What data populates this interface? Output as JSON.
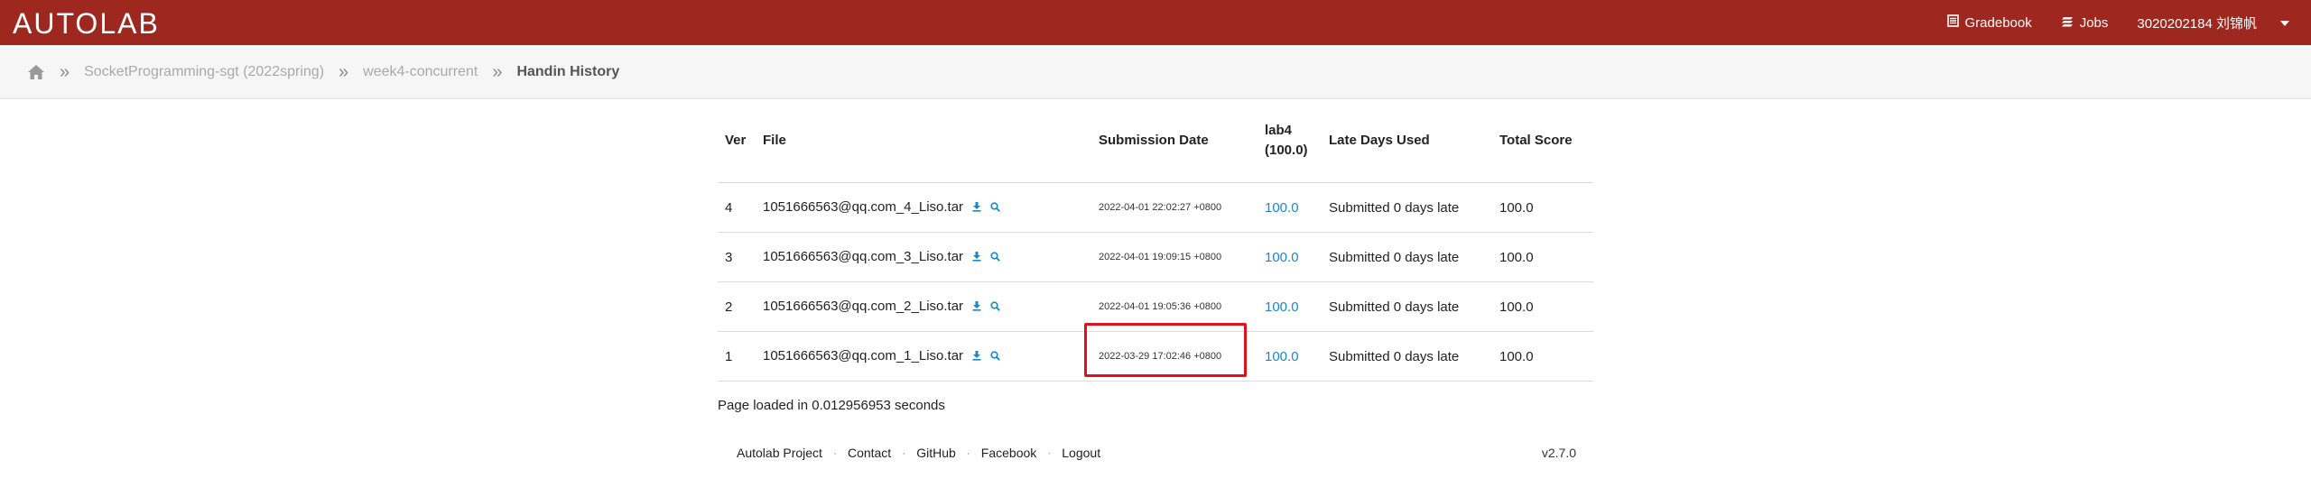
{
  "topbar": {
    "logo": "AUTOLAB",
    "gradebook_label": "Gradebook",
    "jobs_label": "Jobs",
    "user_label": "3020202184 刘锦帆"
  },
  "breadcrumb": {
    "course": "SocketProgramming-sgt (2022spring)",
    "assessment": "week4-concurrent",
    "current": "Handin History"
  },
  "table": {
    "headers": {
      "ver": "Ver",
      "file": "File",
      "date": "Submission Date",
      "lab": "lab4",
      "lab_max": "(100.0)",
      "late": "Late Days Used",
      "total": "Total Score"
    },
    "rows": [
      {
        "ver": "4",
        "file": "1051666563@qq.com_4_Liso.tar",
        "date": "2022-04-01 22:02:27 +0800",
        "lab": "100.0",
        "late": "Submitted 0 days late",
        "total": "100.0"
      },
      {
        "ver": "3",
        "file": "1051666563@qq.com_3_Liso.tar",
        "date": "2022-04-01 19:09:15 +0800",
        "lab": "100.0",
        "late": "Submitted 0 days late",
        "total": "100.0"
      },
      {
        "ver": "2",
        "file": "1051666563@qq.com_2_Liso.tar",
        "date": "2022-04-01 19:05:36 +0800",
        "lab": "100.0",
        "late": "Submitted 0 days late",
        "total": "100.0"
      },
      {
        "ver": "1",
        "file": "1051666563@qq.com_1_Liso.tar",
        "date": "2022-03-29 17:02:46 +0800",
        "lab": "100.0",
        "late": "Submitted 0 days late",
        "total": "100.0"
      }
    ]
  },
  "page_load": "Page loaded in 0.012956953 seconds",
  "footer": {
    "links": [
      "Autolab Project",
      "Contact",
      "GitHub",
      "Facebook",
      "Logout"
    ],
    "version": "v2.7.0"
  },
  "colors": {
    "topbar": "#9e2820",
    "link": "#1a87c9",
    "highlight": "#e0101c"
  },
  "icons": [
    "home-icon",
    "gradebook-icon",
    "jobs-icon",
    "caret-down-icon",
    "download-icon",
    "magnify-icon"
  ]
}
